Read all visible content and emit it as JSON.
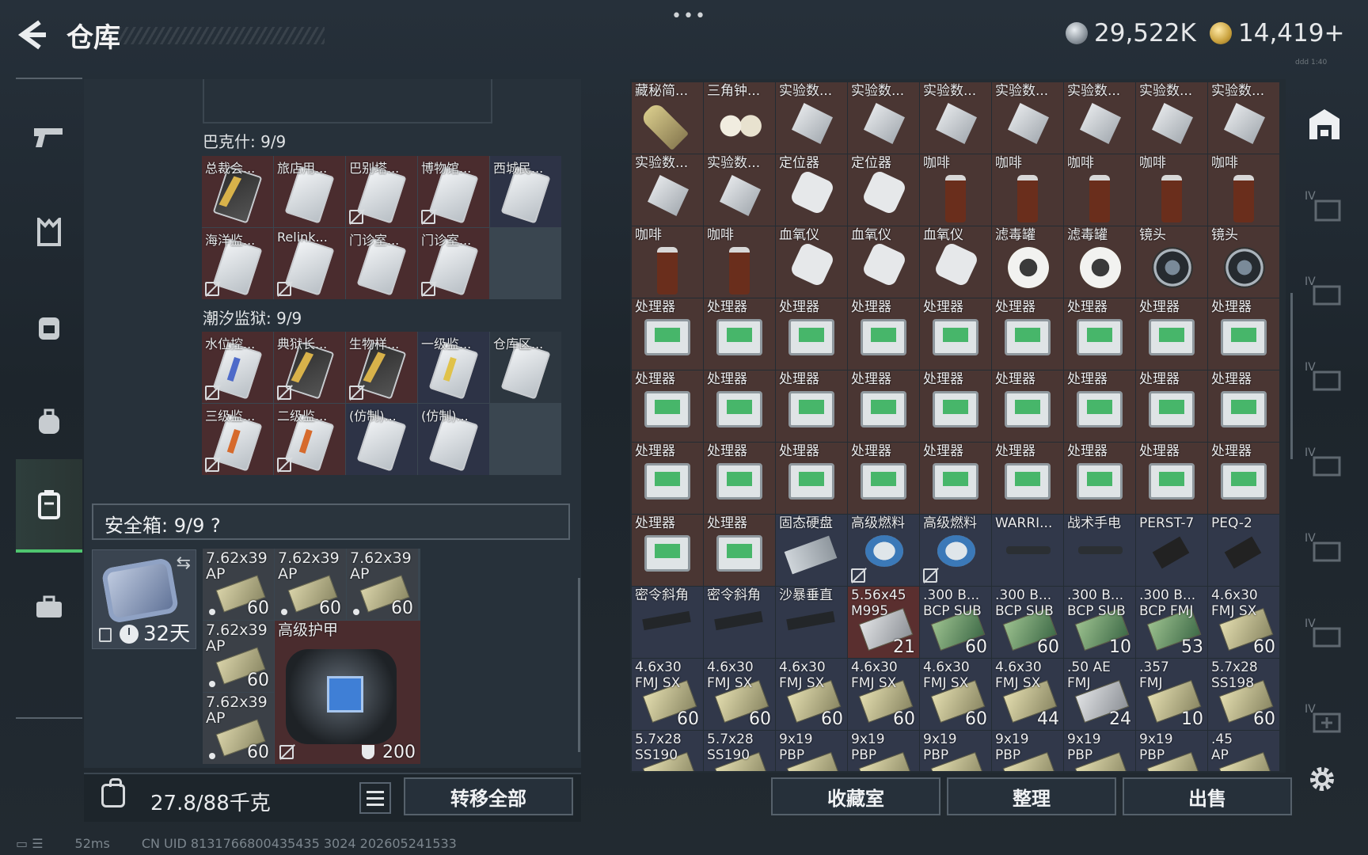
{
  "header": {
    "title": "仓库",
    "currency1": "29,522K",
    "currency2": "14,419+",
    "tiny": "ddd 1:40",
    "menu": "•••"
  },
  "left": {
    "section1": {
      "title": "巴克什: 9/9",
      "items": [
        {
          "label": "总裁会...",
          "style": "red",
          "card": "blk",
          "nosell": false
        },
        {
          "label": "旅店用...",
          "style": "red",
          "card": "",
          "nosell": false
        },
        {
          "label": "巴别塔...",
          "style": "red",
          "card": "",
          "nosell": true
        },
        {
          "label": "博物馆...",
          "style": "red",
          "card": "",
          "nosell": true
        },
        {
          "label": "西城民...",
          "style": "blue",
          "card": "",
          "nosell": false
        },
        {
          "label": "海洋监...",
          "style": "red",
          "card": "",
          "nosell": true
        },
        {
          "label": "Relink...",
          "style": "red",
          "card": "",
          "nosell": true
        },
        {
          "label": "门诊室...",
          "style": "red",
          "card": "",
          "nosell": false
        },
        {
          "label": "门诊室...",
          "style": "red",
          "card": "",
          "nosell": true
        }
      ]
    },
    "section2": {
      "title": "潮汐监狱: 9/9",
      "items": [
        {
          "label": "水位控...",
          "style": "red",
          "card": "blu",
          "nosell": true
        },
        {
          "label": "典狱长...",
          "style": "red",
          "card": "blk",
          "nosell": true
        },
        {
          "label": "生物样...",
          "style": "red",
          "card": "blk",
          "nosell": true
        },
        {
          "label": "一级监...",
          "style": "blue",
          "card": "yel",
          "nosell": false
        },
        {
          "label": "仓库区...",
          "style": "",
          "card": "",
          "nosell": false
        },
        {
          "label": "三级监...",
          "style": "red",
          "card": "orange",
          "nosell": true
        },
        {
          "label": "二级监...",
          "style": "red",
          "card": "orange",
          "nosell": true
        },
        {
          "label": "(仿制)...",
          "style": "blue",
          "card": "",
          "nosell": false
        },
        {
          "label": "(仿制)...",
          "style": "blue",
          "card": "",
          "nosell": false
        }
      ]
    },
    "safe": {
      "title": "安全箱: 9/9",
      "help": "?",
      "days": "32天"
    },
    "ammo": [
      {
        "label": "7.62x39\nAP",
        "count": "60"
      },
      {
        "label": "7.62x39\nAP",
        "count": "60"
      },
      {
        "label": "7.62x39\nAP",
        "count": "60"
      },
      {
        "label": "7.62x39\nAP",
        "count": "60"
      },
      {
        "label": "7.62x39\nAP",
        "count": "60"
      }
    ],
    "armor": {
      "label": "高级护甲",
      "value": "200"
    },
    "bottom": {
      "weight": "27.8/88千克",
      "transfer": "转移全部"
    }
  },
  "right": {
    "items": [
      {
        "label": "藏秘简...",
        "icon": "bullet",
        "style": ""
      },
      {
        "label": "三角钟...",
        "icon": "eggs",
        "style": ""
      },
      {
        "label": "实验数...",
        "icon": "usb",
        "style": ""
      },
      {
        "label": "实验数...",
        "icon": "usb",
        "style": ""
      },
      {
        "label": "实验数...",
        "icon": "usb",
        "style": ""
      },
      {
        "label": "实验数...",
        "icon": "usb",
        "style": ""
      },
      {
        "label": "实验数...",
        "icon": "usb",
        "style": ""
      },
      {
        "label": "实验数...",
        "icon": "usb",
        "style": ""
      },
      {
        "label": "实验数...",
        "icon": "usb",
        "style": ""
      },
      {
        "label": "实验数...",
        "icon": "usb",
        "style": ""
      },
      {
        "label": "实验数...",
        "icon": "usb",
        "style": ""
      },
      {
        "label": "定位器",
        "icon": "oxi",
        "style": ""
      },
      {
        "label": "定位器",
        "icon": "oxi",
        "style": ""
      },
      {
        "label": "咖啡",
        "icon": "coffee",
        "style": ""
      },
      {
        "label": "咖啡",
        "icon": "coffee",
        "style": ""
      },
      {
        "label": "咖啡",
        "icon": "coffee",
        "style": ""
      },
      {
        "label": "咖啡",
        "icon": "coffee",
        "style": ""
      },
      {
        "label": "咖啡",
        "icon": "coffee",
        "style": ""
      },
      {
        "label": "咖啡",
        "icon": "coffee",
        "style": ""
      },
      {
        "label": "咖啡",
        "icon": "coffee",
        "style": ""
      },
      {
        "label": "血氧仪",
        "icon": "oxi",
        "style": ""
      },
      {
        "label": "血氧仪",
        "icon": "oxi",
        "style": ""
      },
      {
        "label": "血氧仪",
        "icon": "oxi",
        "style": ""
      },
      {
        "label": "滤毒罐",
        "icon": "filter",
        "style": ""
      },
      {
        "label": "滤毒罐",
        "icon": "filter",
        "style": ""
      },
      {
        "label": "镜头",
        "icon": "lens",
        "style": ""
      },
      {
        "label": "镜头",
        "icon": "lens",
        "style": ""
      },
      {
        "label": "处理器",
        "icon": "proc",
        "style": ""
      },
      {
        "label": "处理器",
        "icon": "proc",
        "style": ""
      },
      {
        "label": "处理器",
        "icon": "proc",
        "style": ""
      },
      {
        "label": "处理器",
        "icon": "proc",
        "style": ""
      },
      {
        "label": "处理器",
        "icon": "proc",
        "style": ""
      },
      {
        "label": "处理器",
        "icon": "proc",
        "style": ""
      },
      {
        "label": "处理器",
        "icon": "proc",
        "style": ""
      },
      {
        "label": "处理器",
        "icon": "proc",
        "style": ""
      },
      {
        "label": "处理器",
        "icon": "proc",
        "style": ""
      },
      {
        "label": "处理器",
        "icon": "proc",
        "style": ""
      },
      {
        "label": "处理器",
        "icon": "proc",
        "style": ""
      },
      {
        "label": "处理器",
        "icon": "proc",
        "style": ""
      },
      {
        "label": "处理器",
        "icon": "proc",
        "style": ""
      },
      {
        "label": "处理器",
        "icon": "proc",
        "style": ""
      },
      {
        "label": "处理器",
        "icon": "proc",
        "style": ""
      },
      {
        "label": "处理器",
        "icon": "proc",
        "style": ""
      },
      {
        "label": "处理器",
        "icon": "proc",
        "style": ""
      },
      {
        "label": "处理器",
        "icon": "proc",
        "style": ""
      },
      {
        "label": "处理器",
        "icon": "proc",
        "style": ""
      },
      {
        "label": "处理器",
        "icon": "proc",
        "style": ""
      },
      {
        "label": "处理器",
        "icon": "proc",
        "style": ""
      },
      {
        "label": "处理器",
        "icon": "proc",
        "style": ""
      },
      {
        "label": "处理器",
        "icon": "proc",
        "style": ""
      },
      {
        "label": "处理器",
        "icon": "proc",
        "style": ""
      },
      {
        "label": "处理器",
        "icon": "proc",
        "style": ""
      },
      {
        "label": "处理器",
        "icon": "proc",
        "style": ""
      },
      {
        "label": "处理器",
        "icon": "proc",
        "style": ""
      },
      {
        "label": "处理器",
        "icon": "proc",
        "style": ""
      },
      {
        "label": "处理器",
        "icon": "proc",
        "style": ""
      },
      {
        "label": "固态硬盘",
        "icon": "disk",
        "style": "blue"
      },
      {
        "label": "高级燃料",
        "icon": "fuel",
        "style": "blue",
        "nosell": true
      },
      {
        "label": "高级燃料",
        "icon": "fuel",
        "style": "blue",
        "nosell": true
      },
      {
        "label": "WARRI...",
        "icon": "flash",
        "style": "blue"
      },
      {
        "label": "战术手电",
        "icon": "flash",
        "style": "blue"
      },
      {
        "label": "PERST-7",
        "icon": "laser",
        "style": "blue"
      },
      {
        "label": "PEQ-2",
        "icon": "laser",
        "style": "blue"
      },
      {
        "label": "密令斜角",
        "icon": "rail",
        "style": "blue"
      },
      {
        "label": "密令斜角",
        "icon": "rail",
        "style": "blue"
      },
      {
        "label": "沙暴垂直",
        "icon": "rail",
        "style": "blue"
      },
      {
        "label": "5.56x45\nM995",
        "icon": "ammo grey",
        "style": "red",
        "count": "21"
      },
      {
        "label": ".300 B...\nBCP SUB",
        "icon": "ammo green",
        "style": "blue",
        "count": "60"
      },
      {
        "label": ".300 B...\nBCP SUB",
        "icon": "ammo green",
        "style": "blue",
        "count": "60"
      },
      {
        "label": ".300 B...\nBCP SUB",
        "icon": "ammo green",
        "style": "blue",
        "count": "10"
      },
      {
        "label": ".300 B...\nBCP FMJ",
        "icon": "ammo green",
        "style": "blue",
        "count": "53"
      },
      {
        "label": "4.6x30\nFMJ SX",
        "icon": "ammo",
        "style": "blue",
        "count": "60"
      },
      {
        "label": "4.6x30\nFMJ SX",
        "icon": "ammo",
        "style": "blue",
        "count": "60"
      },
      {
        "label": "4.6x30\nFMJ SX",
        "icon": "ammo",
        "style": "blue",
        "count": "60"
      },
      {
        "label": "4.6x30\nFMJ SX",
        "icon": "ammo",
        "style": "blue",
        "count": "60"
      },
      {
        "label": "4.6x30\nFMJ SX",
        "icon": "ammo",
        "style": "blue",
        "count": "60"
      },
      {
        "label": "4.6x30\nFMJ SX",
        "icon": "ammo",
        "style": "blue",
        "count": "60"
      },
      {
        "label": "4.6x30\nFMJ SX",
        "icon": "ammo",
        "style": "blue",
        "count": "44"
      },
      {
        "label": ".50 AE\nFMJ",
        "icon": "ammo grey",
        "style": "blue",
        "count": "24"
      },
      {
        "label": ".357\nFMJ",
        "icon": "ammo",
        "style": "blue",
        "count": "10"
      },
      {
        "label": "5.7x28\nSS198",
        "icon": "ammo",
        "style": "blue",
        "count": "60"
      },
      {
        "label": "5.7x28\nSS190",
        "icon": "ammo",
        "style": "blue"
      },
      {
        "label": "5.7x28\nSS190",
        "icon": "ammo",
        "style": "blue"
      },
      {
        "label": "9x19\nPBP",
        "icon": "ammo",
        "style": "blue"
      },
      {
        "label": "9x19\nPBP",
        "icon": "ammo",
        "style": "blue"
      },
      {
        "label": "9x19\nPBP",
        "icon": "ammo",
        "style": "blue"
      },
      {
        "label": "9x19\nPBP",
        "icon": "ammo",
        "style": "blue"
      },
      {
        "label": "9x19\nPBP",
        "icon": "ammo",
        "style": "blue"
      },
      {
        "label": "9x19\nPBP",
        "icon": "ammo",
        "style": "blue"
      },
      {
        "label": ".45\nAP",
        "icon": "ammo",
        "style": "blue"
      }
    ],
    "buttons": {
      "collection": "收藏室",
      "sort": "整理",
      "sell": "出售"
    }
  },
  "status": {
    "ping": "52ms",
    "uid": "CN UID 8131766800435435 3024 202605241533"
  },
  "colors": {
    "accent": "#4fc56f",
    "panel": "#27313a"
  }
}
